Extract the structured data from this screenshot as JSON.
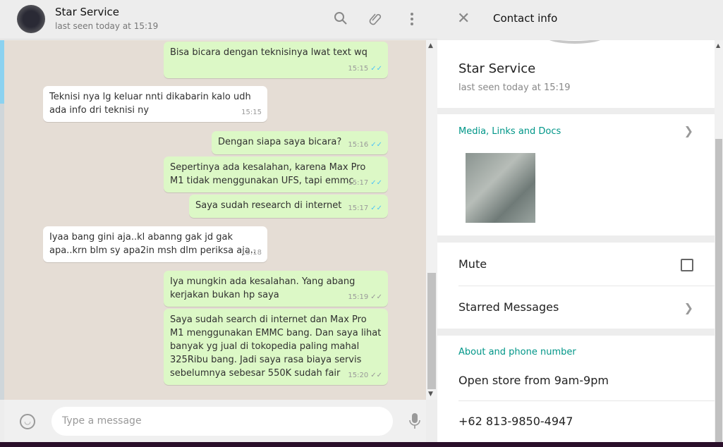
{
  "chat": {
    "contact_name": "Star Service",
    "status": "last seen today at 15:19",
    "icons": [
      "search-icon",
      "attach-icon",
      "menu-icon"
    ]
  },
  "messages": [
    {
      "dir": "out",
      "text": "Bisa bicara dengan teknisinya lwat text wq",
      "time": "15:15",
      "read": true
    },
    {
      "dir": "in",
      "text": "Teknisi nya lg keluar nnti dikabarin kalo udh ada info dri teknisi ny",
      "time": "15:15"
    },
    {
      "dir": "out",
      "text": "Dengan siapa saya bicara?",
      "time": "15:16",
      "read": true
    },
    {
      "dir": "out",
      "text": "Sepertinya ada kesalahan, karena Max Pro M1 tidak menggunakan UFS, tapi emmc",
      "time": "15:17",
      "read": true
    },
    {
      "dir": "out",
      "text": "Saya sudah research di internet",
      "time": "15:17",
      "read": true
    },
    {
      "dir": "in",
      "text": "Iyaa bang gini aja..kl abanng gak jd gak apa..krn blm sy apa2in msh dlm periksa aja..",
      "time": "15:18"
    },
    {
      "dir": "out",
      "text": "Iya mungkin ada kesalahan. Yang abang kerjakan bukan hp saya",
      "time": "15:19",
      "read": false
    },
    {
      "dir": "out",
      "text": "Saya sudah search di internet dan Max Pro M1 menggunakan EMMC bang. Dan saya lihat banyak yg jual di tokopedia paling mahal 325Ribu bang. Jadi saya rasa biaya servis sebelumnya sebesar 550K sudah fair",
      "time": "15:20",
      "read": false
    }
  ],
  "composer": {
    "placeholder": "Type a message"
  },
  "contact_info": {
    "title": "Contact info",
    "name": "Star Service",
    "status": "last seen today at 15:19",
    "media_label": "Media, Links and Docs",
    "mute_label": "Mute",
    "mute_checked": false,
    "starred_label": "Starred Messages",
    "about_label": "About and phone number",
    "about": "Open store from 9am-9pm",
    "phone": "+62 813-9850-4947"
  },
  "colors": {
    "outgoing": "#dcf8c6",
    "incoming": "#ffffff",
    "accent": "#009688",
    "read_tick": "#4fc3f7"
  }
}
